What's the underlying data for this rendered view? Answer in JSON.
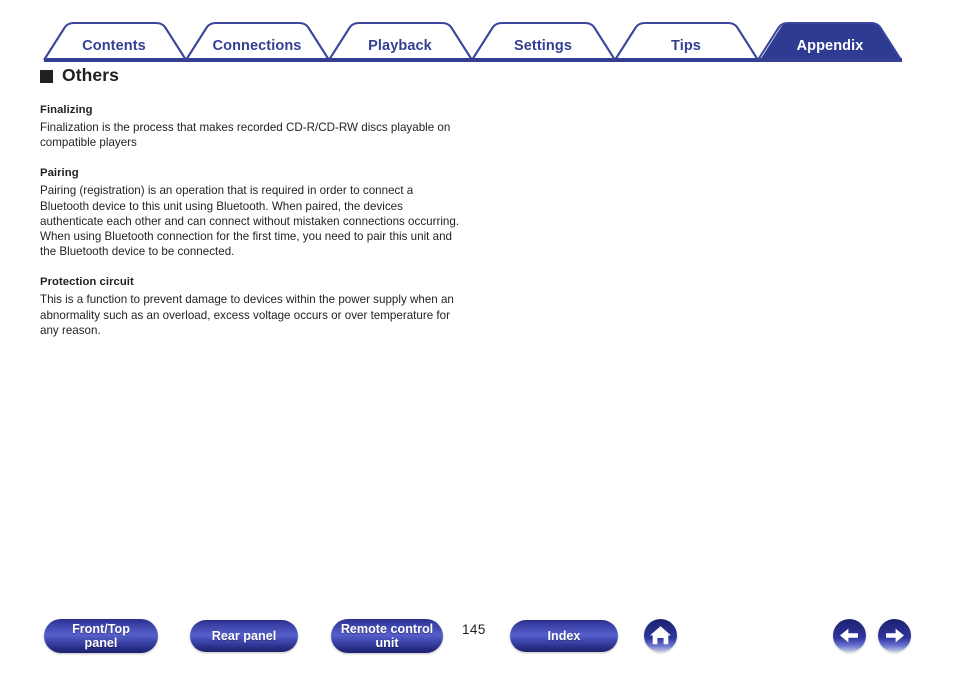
{
  "tabs": [
    {
      "label": "Contents",
      "active": false,
      "center": 114
    },
    {
      "label": "Connections",
      "active": false,
      "center": 257
    },
    {
      "label": "Playback",
      "active": false,
      "center": 400
    },
    {
      "label": "Settings",
      "active": false,
      "center": 543
    },
    {
      "label": "Tips",
      "active": false,
      "center": 686
    },
    {
      "label": "Appendix",
      "active": true,
      "center": 830
    }
  ],
  "content": {
    "section_title": "Others",
    "bullet_icon": "filled-square-bullet",
    "entries": [
      {
        "term": "Finalizing",
        "description": "Finalization is the process that makes recorded CD-R/CD-RW discs playable on compatible players"
      },
      {
        "term": "Pairing",
        "description": "Pairing (registration) is an operation that is required in order to connect a Bluetooth device to this unit using Bluetooth. When paired, the devices authenticate each other and can connect without mistaken connections occurring.\nWhen using Bluetooth connection for the first time, you need to pair this unit and the Bluetooth device to be connected."
      },
      {
        "term": "Protection circuit",
        "description": "This is a function to prevent damage to devices within the power supply when an abnormality such as an overload, excess voltage occurs or over temperature for any reason."
      }
    ]
  },
  "footer": {
    "front_top_panel": "Front/Top\npanel",
    "rear_panel": "Rear panel",
    "remote_control_unit": "Remote control\nunit",
    "page_number": "145",
    "index": "Index",
    "home_icon": "home-icon",
    "prev_icon": "arrow-left-icon",
    "next_icon": "arrow-right-icon"
  },
  "colors": {
    "navy": "#343f94",
    "navy_dark": "#2e3b93",
    "text": "#231f20",
    "white": "#ffffff"
  }
}
